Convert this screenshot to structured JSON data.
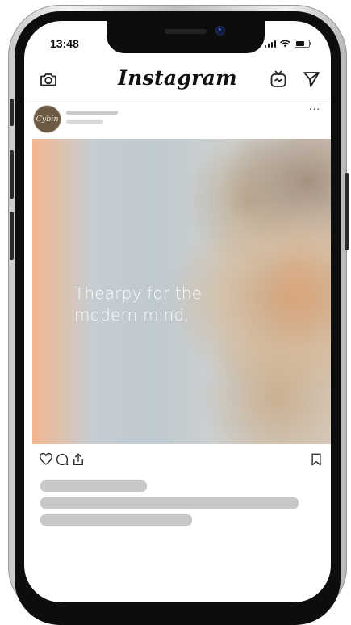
{
  "status_bar": {
    "time": "13:48"
  },
  "header": {
    "logo_text": "Instagram",
    "icons": [
      "camera-icon",
      "igtv-icon",
      "direct-send-icon"
    ]
  },
  "post": {
    "avatar_text": "Cybin",
    "more_icon": "…",
    "image_caption_text": "Thearpy for the modern mind.",
    "image_caption_lines": [
      "Thearpy for the",
      "modern mind."
    ],
    "actions": [
      "heart-icon",
      "comment-icon",
      "share-icon",
      "bookmark-icon"
    ]
  },
  "colors": {
    "text": "#111111",
    "placeholder": "#c8c8c8",
    "avatar_bg": "#6b5a44",
    "bezel": "#0d0d0d"
  }
}
